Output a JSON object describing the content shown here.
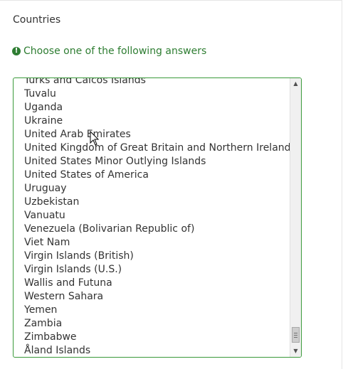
{
  "question": {
    "title": "Countries",
    "hint": "Choose one of the following answers",
    "hint_icon": "exclamation-circle-icon",
    "options": [
      "Turks and Caicos Islands",
      "Tuvalu",
      "Uganda",
      "Ukraine",
      "United Arab Emirates",
      "United Kingdom of Great Britain and Northern Ireland",
      "United States Minor Outlying Islands",
      "United States of America",
      "Uruguay",
      "Uzbekistan",
      "Vanuatu",
      "Venezuela (Bolivarian Republic of)",
      "Viet Nam",
      "Virgin Islands (British)",
      "Virgin Islands (U.S.)",
      "Wallis and Futuna",
      "Western Sahara",
      "Yemen",
      "Zambia",
      "Zimbabwe",
      "Åland Islands"
    ]
  },
  "colors": {
    "hint": "#2e7d32",
    "listbox_border": "#3a9a3a",
    "text": "#333333"
  },
  "scroll": {
    "position_fraction": 1.0
  }
}
